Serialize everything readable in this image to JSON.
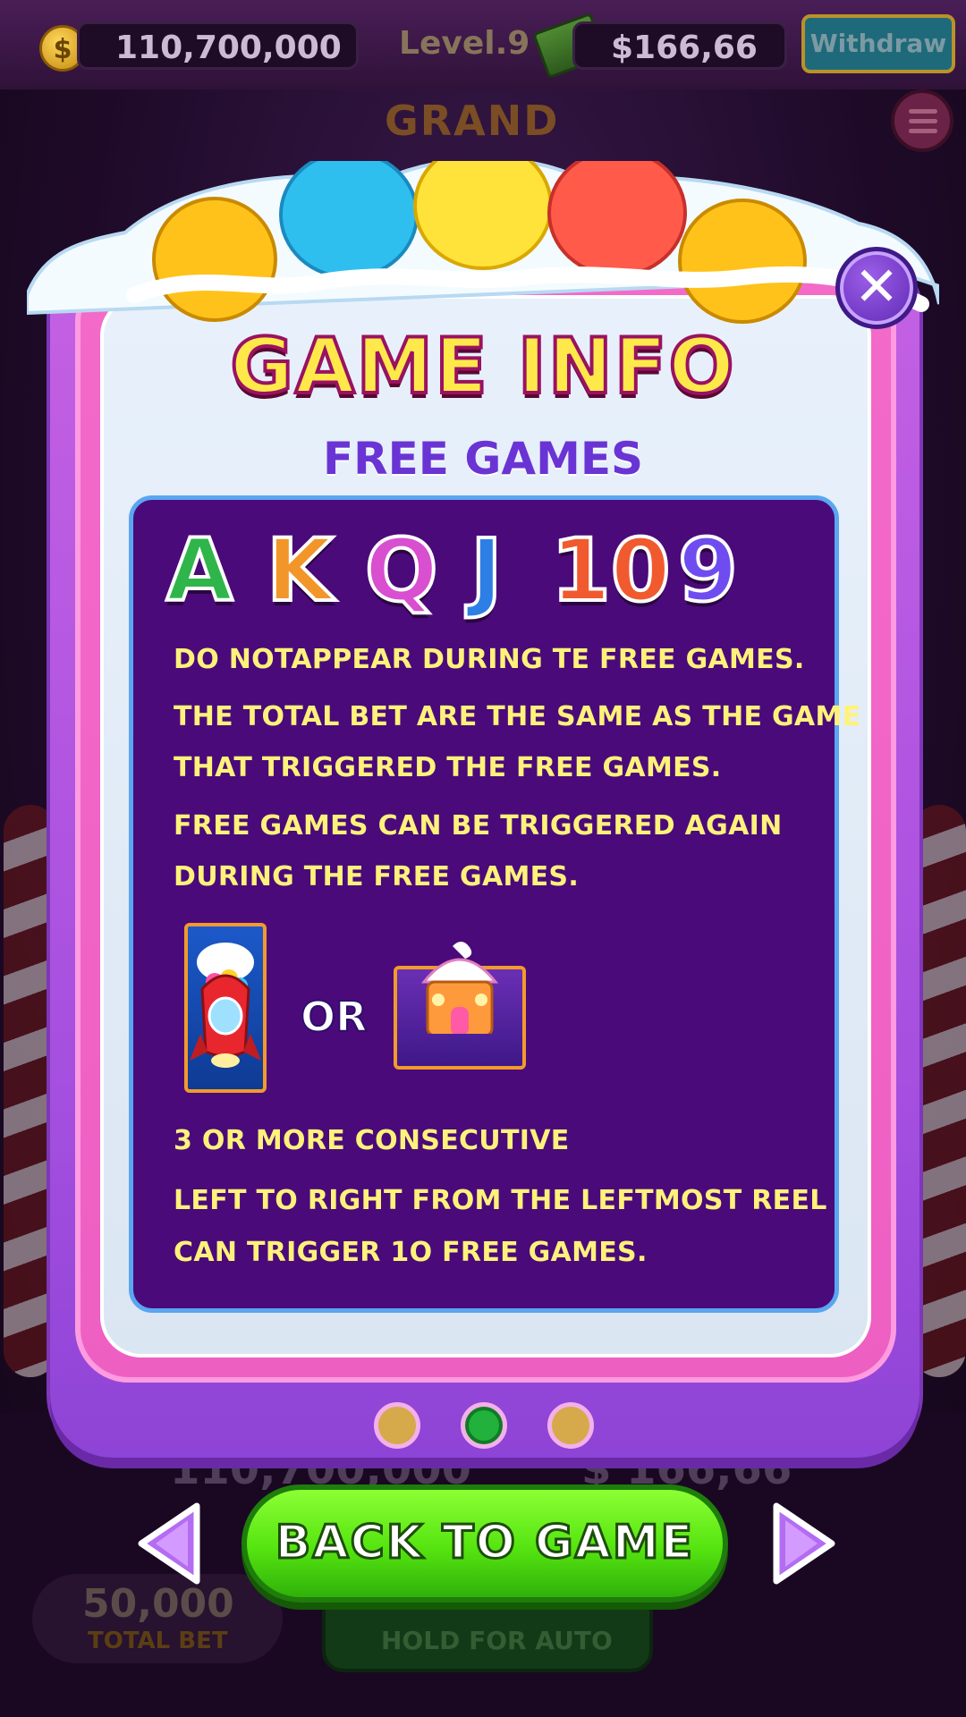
{
  "top_bar": {
    "coin_symbol": "$",
    "coin_balance": "110,700,000",
    "level": "Level.9",
    "cash_balance": "$166,66",
    "withdraw_label": "Withdraw"
  },
  "background": {
    "jackpot_label": "GRAND",
    "balance_repeat": "110,700,000",
    "cash_repeat": "$ 166,66",
    "total_bet_value": "50,000",
    "total_bet_label": "TOTAL BET",
    "spin_hint": "HOLD FOR AUTO"
  },
  "modal": {
    "title": "GAME INFO",
    "subtitle": "FREE GAMES",
    "close_symbol": "✕",
    "card_letters": [
      "A",
      "K",
      "Q",
      "J",
      "10",
      "9"
    ],
    "card_letter_colors": [
      "#2fb54a",
      "#f2962a",
      "#d84fd0",
      "#2d7fe6",
      "#f15a2e",
      "#6f4cf0"
    ],
    "lines": [
      "DO NOTAPPEAR DURING TE FREE GAMES.",
      "THE TOTAL BET ARE THE SAME AS THE GAME",
      "THAT TRIGGERED THE FREE GAMES.",
      "FREE GAMES CAN BE TRIGGERED AGAIN",
      "DURING THE FREE GAMES.",
      "3 OR MORE CONSECUTIVE",
      "LEFT TO RIGHT FROM THE LEFTMOST REEL",
      "CAN TRIGGER 1O FREE GAMES."
    ],
    "or_label": "OR",
    "page_count": 3,
    "active_page": 2,
    "back_label": "BACK TO GAME"
  },
  "colors": {
    "accent_pink": "#ee5fc2",
    "accent_purple": "#a54fe0",
    "content_bg": "#4a0a7a",
    "text_yellow": "#fff27a",
    "button_green": "#55e410"
  },
  "icons": {
    "scatter_symbols": [
      "rocket-symbol-icon",
      "cupcake-house-symbol-icon"
    ],
    "nav": [
      "arrow-left-icon",
      "arrow-right-icon"
    ]
  }
}
